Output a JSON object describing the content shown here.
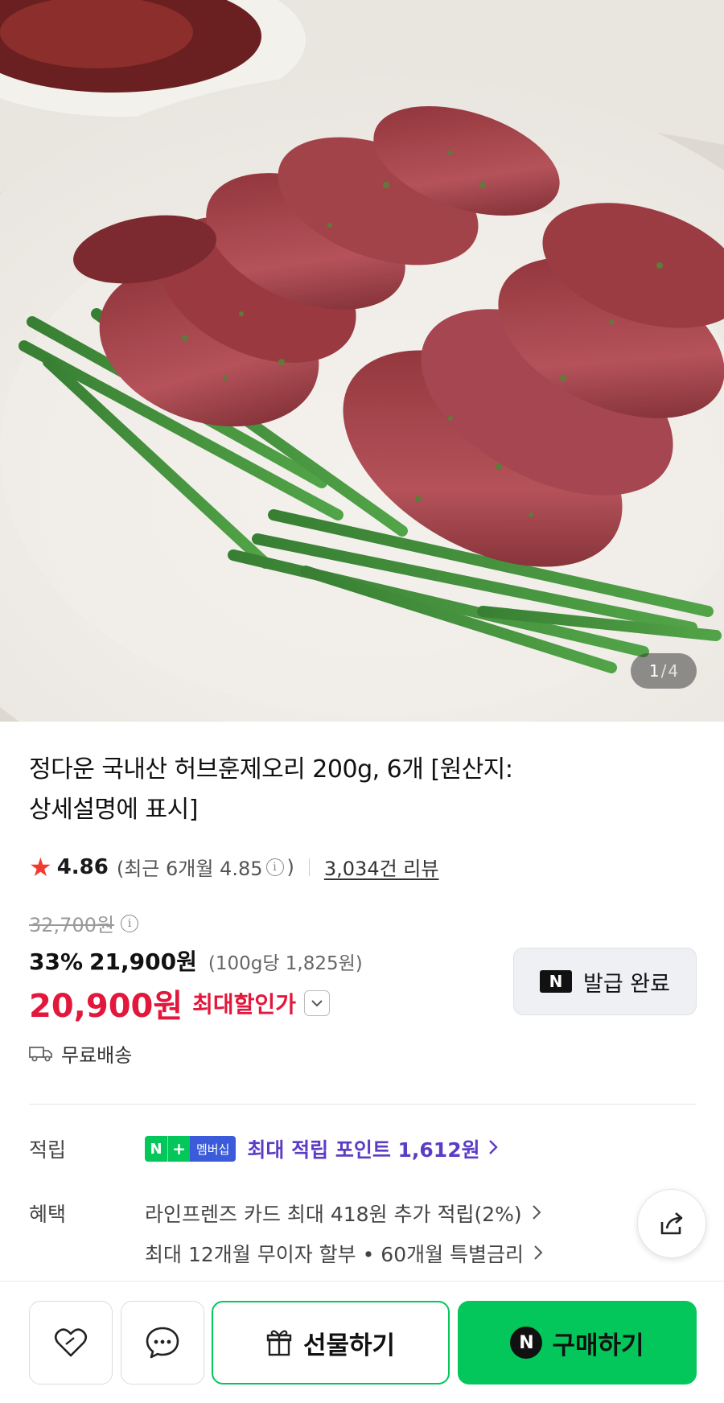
{
  "product": {
    "image_counter": {
      "current": "1",
      "separator": "/",
      "total": "4"
    },
    "title_line1": "정다운 국내산 허브훈제오리 200g, 6개 [원산지:",
    "title_line2": "상세설명에 표시]"
  },
  "rating": {
    "score": "4.86",
    "recent_label": "(최근 6개월 4.85",
    "recent_close": ")",
    "review_link": "3,034건 리뷰"
  },
  "price": {
    "original": "32,700원",
    "discount_rate": "33%",
    "sale": "21,900원",
    "unit": "(100g당 1,825원)",
    "best": "20,900원",
    "best_label": "최대할인가"
  },
  "coupon": {
    "label": "발급 완료",
    "logo": "N"
  },
  "shipping": {
    "label": "무료배송",
    "icon": "truck-icon"
  },
  "points": {
    "row_label": "적립",
    "badge_n": "N",
    "badge_plus": "+",
    "badge_text": "멤버십",
    "text": "최대 적립 포인트 1,612원"
  },
  "benefits": {
    "row_label": "혜택",
    "line1": "라인프렌즈 카드 최대 418원 추가 적립(2%)",
    "line2": "최대 12개월 무이자 할부 • 60개월 특별금리"
  },
  "bottom_bar": {
    "gift_label": "선물하기",
    "buy_label": "구매하기",
    "buy_logo": "N"
  },
  "colors": {
    "accent_green": "#03c75a",
    "sale_red": "#e3173b",
    "points_purple": "#5b3cc4",
    "star": "#f23a2f"
  }
}
